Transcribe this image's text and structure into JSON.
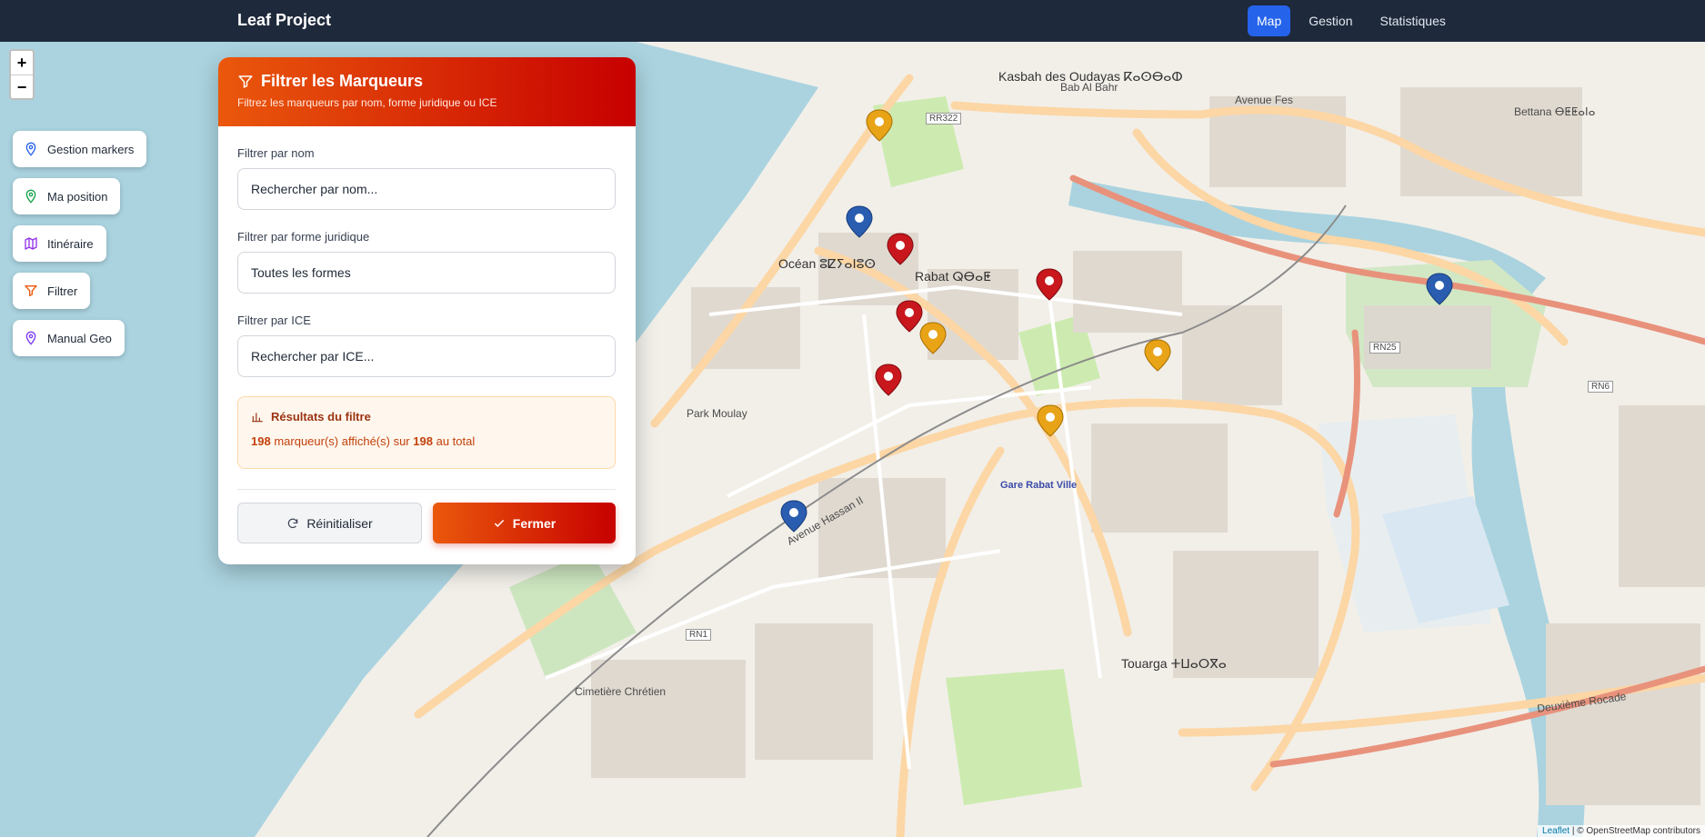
{
  "app": {
    "title": "Leaf Project"
  },
  "nav": [
    {
      "label": "Map",
      "active": true
    },
    {
      "label": "Gestion",
      "active": false
    },
    {
      "label": "Statistiques",
      "active": false
    }
  ],
  "zoom": {
    "in": "+",
    "out": "−"
  },
  "sidebar": {
    "items": [
      {
        "label": "Gestion markers",
        "icon": "map-pin-icon",
        "color": "#2563eb"
      },
      {
        "label": "Ma position",
        "icon": "location-pin-icon",
        "color": "#16a34a"
      },
      {
        "label": "Itinéraire",
        "icon": "map-icon",
        "color": "#9333ea"
      },
      {
        "label": "Filtrer",
        "icon": "filter-icon",
        "color": "#ea580c"
      },
      {
        "label": "Manual Geo",
        "icon": "map-pin-icon",
        "color": "#7c3aed"
      }
    ]
  },
  "filter_panel": {
    "title": "Filtrer les Marqueurs",
    "subtitle": "Filtrez les marqueurs par nom, forme juridique ou ICE",
    "name_label": "Filtrer par nom",
    "name_placeholder": "Rechercher par nom...",
    "forme_label": "Filtrer par forme juridique",
    "forme_value": "Toutes les formes",
    "ice_label": "Filtrer par ICE",
    "ice_placeholder": "Rechercher par ICE...",
    "results_title": "Résultats du filtre",
    "shown": "198",
    "shown_text": "marqueur(s) affiché(s) sur",
    "total": "198",
    "total_text": "au total",
    "reset_label": "Réinitialiser",
    "close_label": "Fermer"
  },
  "map_labels": {
    "kasbah": "Kasbah des Oudayas ⴽⴰⵙⴱⴰⵀ",
    "ocean": "Océan ⵓⵇⵢⴰⵏⵓⵙ",
    "rabat": "Rabat ⵕⴱⴰⵟ",
    "gare": "Gare Rabat Ville",
    "touarga": "Touarga ⵜⵡⴰⵔⴳⴰ",
    "bettana": "Bettana ⴱⵟⵟⴰⵏⴰ",
    "avenue_fes": "Avenue Fes",
    "bab_al_bahr": "Bab Al Bahr",
    "deuxieme_rocade": "Deuxième Rocade",
    "avenue_hassan": "Avenue Hassan II",
    "park": "Park Moulay",
    "cimetiere": "Cimetière Chrétien",
    "rn1": "RN1",
    "rr322": "RR322",
    "rn6": "RN6",
    "rn25": "RN25"
  },
  "attribution": {
    "leaflet": "Leaflet",
    "osm": "| © OpenStreetMap contributors"
  }
}
